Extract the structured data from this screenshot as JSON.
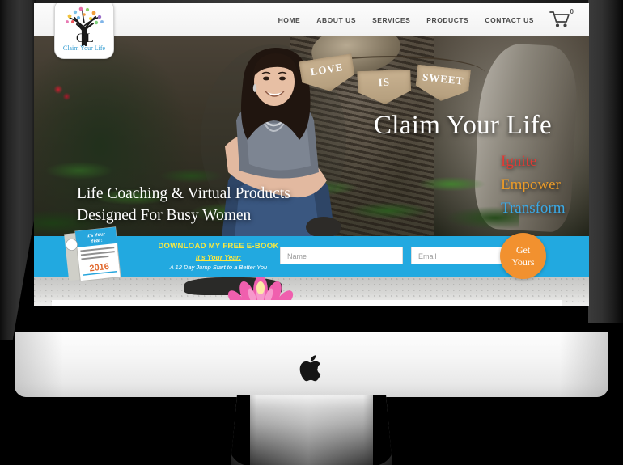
{
  "device": {
    "name": "iMac desktop computer mockup",
    "brand_icon": "apple-logo-icon"
  },
  "site": {
    "logo": {
      "monogram_left": "C",
      "monogram_right": "L",
      "tagline": "Claim Your Life",
      "icon": "tree-logo-icon"
    },
    "nav": {
      "items": [
        {
          "label": "HOME"
        },
        {
          "label": "ABOUT US"
        },
        {
          "label": "SERVICES"
        },
        {
          "label": "PRODUCTS"
        },
        {
          "label": "CONTACT US"
        }
      ],
      "cart": {
        "icon": "shopping-cart-icon",
        "count": "0"
      }
    },
    "hero": {
      "headline": "Claim Your Life",
      "words": [
        {
          "text": "Ignite",
          "color": "#e03a35"
        },
        {
          "text": "Empower",
          "color": "#eb9b28"
        },
        {
          "text": "Transform",
          "color": "#3aa9e6"
        }
      ],
      "subhead_line1": "Life Coaching & Virtual Products",
      "subhead_line2": "Designed For Busy Women",
      "banner_flags": [
        {
          "text": "LOVE"
        },
        {
          "text": "IS"
        },
        {
          "text": "SWEET"
        }
      ],
      "photo_alt": "Smiling woman in gray t-shirt and jeans sitting by a tree"
    },
    "optin": {
      "heading": "DOWNLOAD MY FREE E-BOOK",
      "subheading": "It's Your Year:",
      "tagline": "A 12 Day Jump Start to a Better You",
      "name_placeholder": "Name",
      "email_placeholder": "Email",
      "button_line1": "Get",
      "button_line2": "Yours",
      "ebook": {
        "title": "It's Your Year:",
        "year": "2016",
        "alt": "E-book cover thumbnail"
      },
      "bar_color": "#22a9e0",
      "button_color": "#f2912f",
      "heading_color": "#fbe93f"
    },
    "below_fold": {
      "alt": "Pink lotus flower on light concrete background"
    }
  }
}
